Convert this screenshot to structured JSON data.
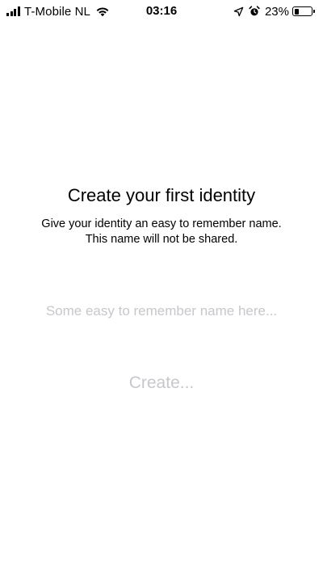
{
  "status_bar": {
    "carrier": "T-Mobile NL",
    "time": "03:16",
    "battery_percent": "23%",
    "battery_level": 0.23,
    "icons": [
      "signal-icon",
      "wifi-icon",
      "location-arrow-icon",
      "alarm-icon",
      "battery-icon"
    ]
  },
  "main": {
    "title": "Create your first identity",
    "subtitle_line1": "Give your identity an easy to remember name.",
    "subtitle_line2": "This name will not be shared.",
    "name_input": {
      "value": "",
      "placeholder": "Some easy to remember name here..."
    },
    "create_label": "Create..."
  },
  "colors": {
    "text": "#000000",
    "placeholder": "#c7c7cc",
    "background": "#ffffff"
  }
}
